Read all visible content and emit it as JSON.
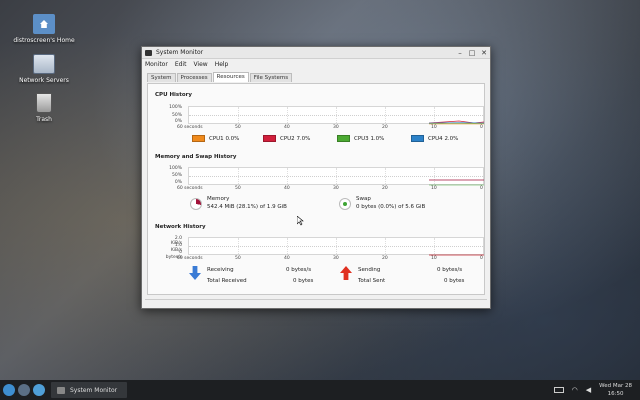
{
  "desktop": {
    "icons": [
      {
        "label": "distroscreen's Home",
        "icon": "home-folder-icon"
      },
      {
        "label": "Network Servers",
        "icon": "network-icon"
      },
      {
        "label": "Trash",
        "icon": "trash-icon"
      }
    ]
  },
  "window": {
    "title": "System Monitor",
    "menu": [
      "Monitor",
      "Edit",
      "View",
      "Help"
    ],
    "tabs": [
      "System",
      "Processes",
      "Resources",
      "File Systems"
    ],
    "active_tab": "Resources"
  },
  "resources": {
    "cpu_title": "CPU History",
    "mem_title": "Memory and Swap History",
    "net_title": "Network History",
    "pct_labels": [
      "100%",
      "50%",
      "0%"
    ],
    "net_labels": [
      "2.0 KiB/s",
      "1.0 KiB/s",
      "0 bytes/s"
    ],
    "x_labels": [
      "60 seconds",
      "50",
      "40",
      "30",
      "20",
      "10",
      "0"
    ],
    "cpus": [
      {
        "name": "CPU1",
        "value": "0.0%",
        "color": "#f08a1c"
      },
      {
        "name": "CPU2",
        "value": "7.0%",
        "color": "#d11f3b"
      },
      {
        "name": "CPU3",
        "value": "1.0%",
        "color": "#4caa32"
      },
      {
        "name": "CPU4",
        "value": "2.0%",
        "color": "#2c82c9"
      }
    ],
    "memory": {
      "label": "Memory",
      "detail": "542.4 MiB (28.1%) of 1.9 GiB",
      "fraction": 0.281,
      "color": "#a3123a"
    },
    "swap": {
      "label": "Swap",
      "detail": "0 bytes (0.0%) of 5.6 GiB",
      "fraction": 0.0,
      "color": "#3fa535"
    },
    "network": {
      "receiving_label": "Receiving",
      "receiving_value": "0 bytes/s",
      "total_received_label": "Total Received",
      "total_received_value": "0 bytes",
      "sending_label": "Sending",
      "sending_value": "0 bytes/s",
      "total_sent_label": "Total Sent",
      "total_sent_value": "0 bytes"
    }
  },
  "taskbar": {
    "task_label": "System Monitor",
    "date": "Wed Mar 28",
    "time": "16:50"
  }
}
